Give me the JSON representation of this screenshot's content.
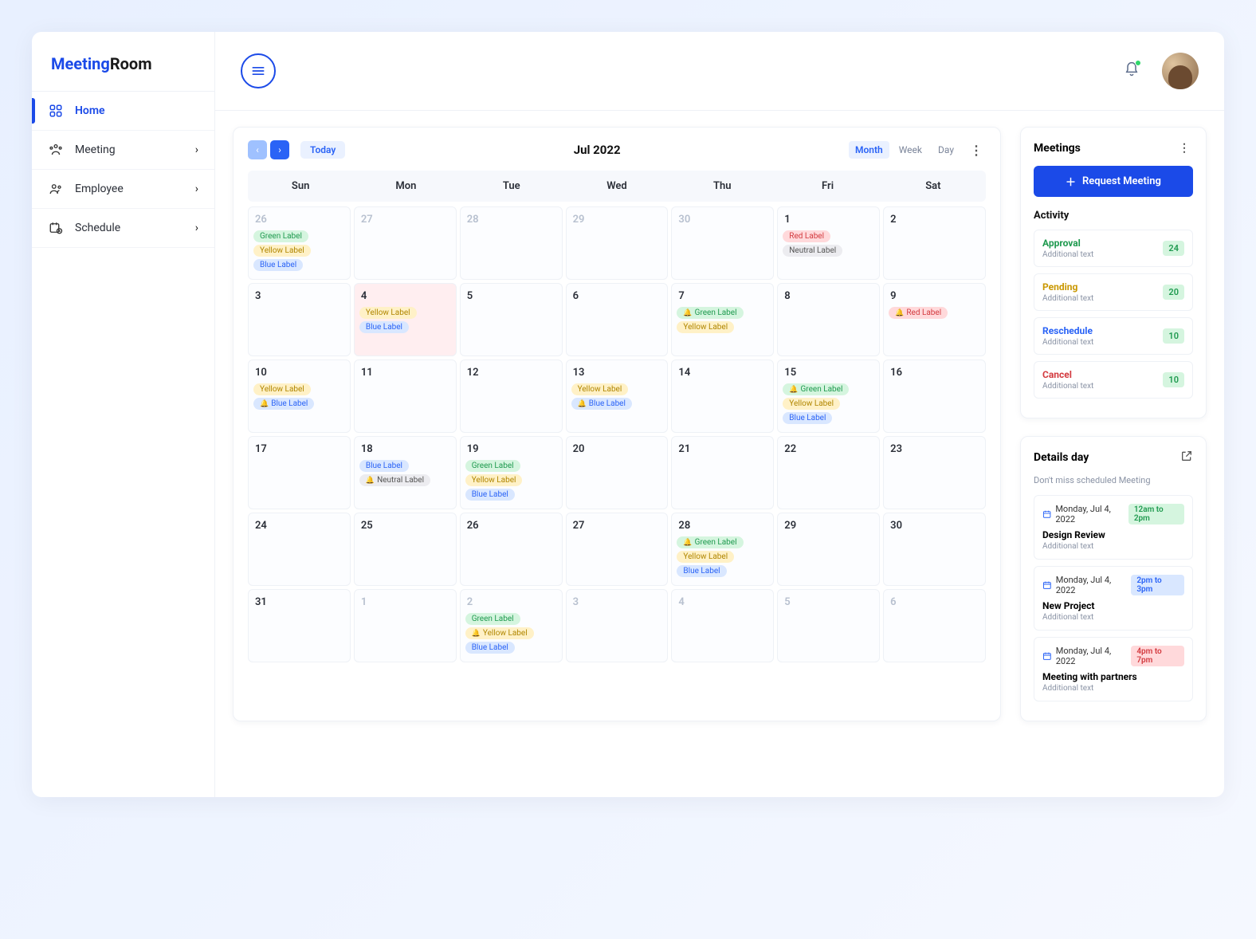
{
  "brand": {
    "part1": "Meeting",
    "part2": "Room"
  },
  "nav": {
    "home": "Home",
    "meeting": "Meeting",
    "employee": "Employee",
    "schedule": "Schedule"
  },
  "calendar": {
    "today": "Today",
    "title": "Jul 2022",
    "views": {
      "month": "Month",
      "week": "Week",
      "day": "Day"
    },
    "dow": [
      "Sun",
      "Mon",
      "Tue",
      "Wed",
      "Thu",
      "Fri",
      "Sat"
    ],
    "weeks": [
      [
        {
          "n": "26",
          "out": true,
          "labels": [
            {
              "t": "Green Label",
              "c": "green"
            },
            {
              "t": "Yellow Label",
              "c": "yellow"
            },
            {
              "t": "Blue Label",
              "c": "blue"
            }
          ]
        },
        {
          "n": "27",
          "out": true
        },
        {
          "n": "28",
          "out": true
        },
        {
          "n": "29",
          "out": true
        },
        {
          "n": "30",
          "out": true
        },
        {
          "n": "1",
          "labels": [
            {
              "t": "Red Label",
              "c": "red"
            },
            {
              "t": "Neutral Label",
              "c": "neutral"
            }
          ]
        },
        {
          "n": "2"
        }
      ],
      [
        {
          "n": "3"
        },
        {
          "n": "4",
          "selected": true,
          "labels": [
            {
              "t": "Yellow Label",
              "c": "yellow"
            },
            {
              "t": "Blue Label",
              "c": "blue"
            }
          ]
        },
        {
          "n": "5"
        },
        {
          "n": "6"
        },
        {
          "n": "7",
          "labels": [
            {
              "t": "Green Label",
              "c": "green",
              "bell": true
            },
            {
              "t": "Yellow Label",
              "c": "yellow"
            }
          ]
        },
        {
          "n": "8"
        },
        {
          "n": "9",
          "labels": [
            {
              "t": "Red Label",
              "c": "red",
              "bell": true
            }
          ]
        }
      ],
      [
        {
          "n": "10",
          "labels": [
            {
              "t": "Yellow Label",
              "c": "yellow"
            },
            {
              "t": "Blue Label",
              "c": "blue",
              "bell": true
            }
          ]
        },
        {
          "n": "11"
        },
        {
          "n": "12"
        },
        {
          "n": "13",
          "labels": [
            {
              "t": "Yellow Label",
              "c": "yellow"
            },
            {
              "t": "Blue Label",
              "c": "blue",
              "bell": true
            }
          ]
        },
        {
          "n": "14"
        },
        {
          "n": "15",
          "labels": [
            {
              "t": "Green Label",
              "c": "green",
              "bell": true
            },
            {
              "t": "Yellow Label",
              "c": "yellow"
            },
            {
              "t": "Blue Label",
              "c": "blue"
            }
          ]
        },
        {
          "n": "16"
        }
      ],
      [
        {
          "n": "17"
        },
        {
          "n": "18",
          "labels": [
            {
              "t": "Blue Label",
              "c": "blue"
            },
            {
              "t": "Neutral Label",
              "c": "neutral",
              "bell": true
            }
          ]
        },
        {
          "n": "19",
          "labels": [
            {
              "t": "Green Label",
              "c": "green"
            },
            {
              "t": "Yellow Label",
              "c": "yellow"
            },
            {
              "t": "Blue Label",
              "c": "blue"
            }
          ]
        },
        {
          "n": "20"
        },
        {
          "n": "21"
        },
        {
          "n": "22"
        },
        {
          "n": "23"
        }
      ],
      [
        {
          "n": "24"
        },
        {
          "n": "25"
        },
        {
          "n": "26"
        },
        {
          "n": "27"
        },
        {
          "n": "28",
          "labels": [
            {
              "t": "Green Label",
              "c": "green",
              "bell": true
            },
            {
              "t": "Yellow Label",
              "c": "yellow"
            },
            {
              "t": "Blue Label",
              "c": "blue"
            }
          ]
        },
        {
          "n": "29"
        },
        {
          "n": "30"
        }
      ],
      [
        {
          "n": "31"
        },
        {
          "n": "1",
          "out": true
        },
        {
          "n": "2",
          "out": true,
          "labels": [
            {
              "t": "Green Label",
              "c": "green"
            },
            {
              "t": "Yellow Label",
              "c": "yellow",
              "bell": true
            },
            {
              "t": "Blue Label",
              "c": "blue"
            }
          ]
        },
        {
          "n": "3",
          "out": true
        },
        {
          "n": "4",
          "out": true
        },
        {
          "n": "5",
          "out": true
        },
        {
          "n": "6",
          "out": true
        }
      ]
    ],
    "label_text": {
      "green": "Green Label",
      "yellow": "Yellow Label",
      "blue": "Blue Label",
      "red": "Red Label",
      "neutral": "Neutral Label"
    }
  },
  "meetings": {
    "title": "Meetings",
    "request": "Request Meeting",
    "activity_title": "Activity",
    "activity": [
      {
        "title": "Approval",
        "sub": "Additional text",
        "count": "24",
        "color": "green"
      },
      {
        "title": "Pending",
        "sub": "Additional text",
        "count": "20",
        "color": "yellow"
      },
      {
        "title": "Reschedule",
        "sub": "Additional text",
        "count": "10",
        "color": "blue"
      },
      {
        "title": "Cancel",
        "sub": "Additional text",
        "count": "10",
        "color": "red"
      }
    ]
  },
  "details": {
    "title": "Details day",
    "sub": "Don't miss scheduled Meeting",
    "items": [
      {
        "date": "Monday, Jul 4, 2022",
        "time": "12am to 2pm",
        "tc": "green",
        "title": "Design Review",
        "sub": "Additional text"
      },
      {
        "date": "Monday, Jul 4, 2022",
        "time": "2pm to 3pm",
        "tc": "blue",
        "title": "New Project",
        "sub": "Additional text"
      },
      {
        "date": "Monday, Jul 4, 2022",
        "time": "4pm to 7pm",
        "tc": "red",
        "title": "Meeting with partners",
        "sub": "Additional text"
      }
    ]
  }
}
